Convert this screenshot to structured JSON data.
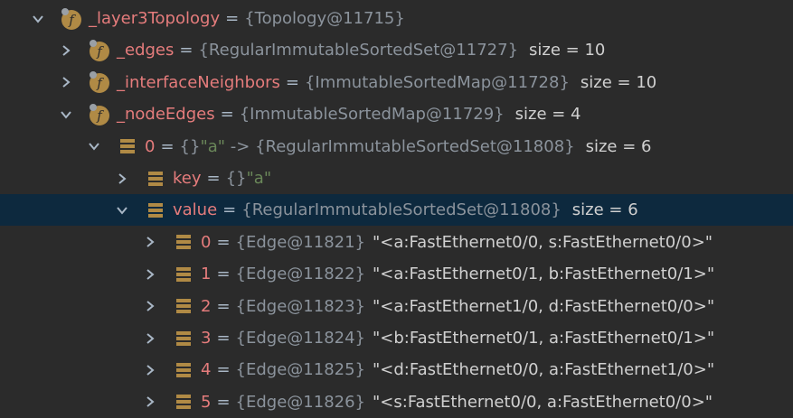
{
  "tree": [
    {
      "depth": 0,
      "expanded": true,
      "icon": "field-icon",
      "name": "_layer3Topology",
      "value": "{Topology@11715}",
      "extra": "",
      "size": ""
    },
    {
      "depth": 1,
      "expanded": false,
      "icon": "field-icon",
      "name": "_edges",
      "value": "{RegularImmutableSortedSet@11727}",
      "extra": "",
      "size": "size = 10"
    },
    {
      "depth": 1,
      "expanded": false,
      "icon": "field-icon",
      "name": "_interfaceNeighbors",
      "value": "{ImmutableSortedMap@11728}",
      "extra": "",
      "size": "size = 10"
    },
    {
      "depth": 1,
      "expanded": true,
      "icon": "field-icon",
      "name": "_nodeEdges",
      "value": "{ImmutableSortedMap@11729}",
      "extra": "",
      "size": "size = 4"
    },
    {
      "depth": 2,
      "expanded": true,
      "icon": "list-icon",
      "name": "0",
      "value": "{} ",
      "extra": "\"a\" -> {RegularImmutableSortedSet@11808}",
      "size": "size = 6"
    },
    {
      "depth": 3,
      "expanded": false,
      "icon": "list-icon",
      "name": "key",
      "value": "{} ",
      "extra": "\"a\"",
      "size": ""
    },
    {
      "depth": 3,
      "expanded": true,
      "icon": "list-icon",
      "name": "value",
      "value": "{RegularImmutableSortedSet@11808}",
      "extra": "",
      "size": "size = 6",
      "selected": true
    },
    {
      "depth": 4,
      "expanded": false,
      "icon": "list-icon",
      "name": "0",
      "value": "{Edge@11821}",
      "extra": "\"<a:FastEthernet0/0, s:FastEthernet0/0>\"",
      "size": ""
    },
    {
      "depth": 4,
      "expanded": false,
      "icon": "list-icon",
      "name": "1",
      "value": "{Edge@11822}",
      "extra": "\"<a:FastEthernet0/1, b:FastEthernet0/1>\"",
      "size": ""
    },
    {
      "depth": 4,
      "expanded": false,
      "icon": "list-icon",
      "name": "2",
      "value": "{Edge@11823}",
      "extra": "\"<a:FastEthernet1/0, d:FastEthernet0/0>\"",
      "size": ""
    },
    {
      "depth": 4,
      "expanded": false,
      "icon": "list-icon",
      "name": "3",
      "value": "{Edge@11824}",
      "extra": "\"<b:FastEthernet0/1, a:FastEthernet0/1>\"",
      "size": ""
    },
    {
      "depth": 4,
      "expanded": false,
      "icon": "list-icon",
      "name": "4",
      "value": "{Edge@11825}",
      "extra": "\"<d:FastEthernet0/0, a:FastEthernet1/0>\"",
      "size": ""
    },
    {
      "depth": 4,
      "expanded": false,
      "icon": "list-icon",
      "name": "5",
      "value": "{Edge@11826}",
      "extra": "\"<s:FastEthernet0/0, a:FastEthernet0/0>\"",
      "size": ""
    }
  ],
  "colors": {
    "background": "#2b2b2b",
    "selection": "#0d293e",
    "field_icon": "#b08a45",
    "list_icon": "#b08a45"
  }
}
